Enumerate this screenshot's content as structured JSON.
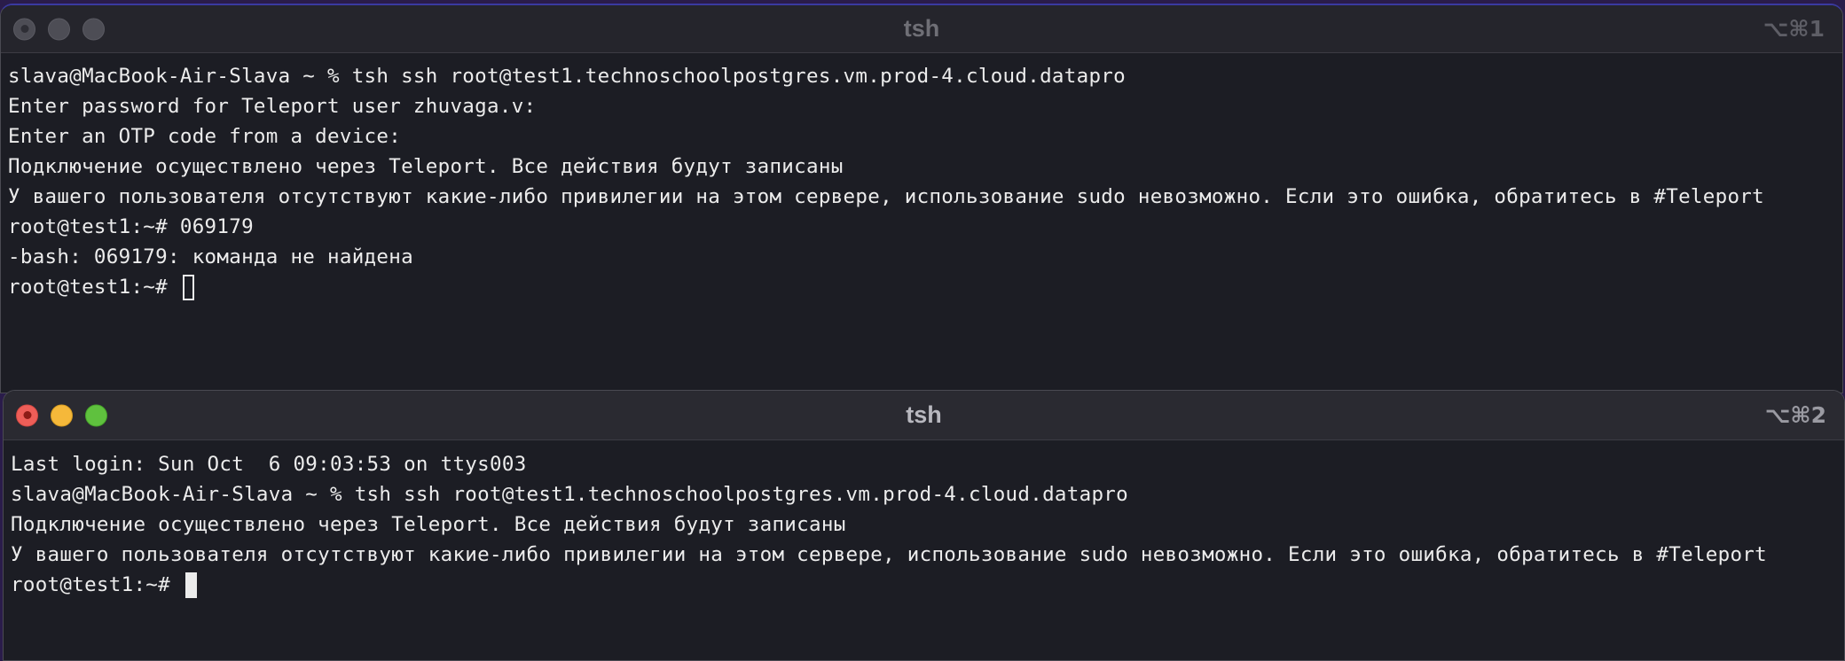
{
  "window1": {
    "title": "tsh",
    "shortcut": "⌥⌘1",
    "lines": [
      "slava@MacBook-Air-Slava ~ % tsh ssh root@test1.technoschoolpostgres.vm.prod-4.cloud.datapro",
      "Enter password for Teleport user zhuvaga.v:",
      "Enter an OTP code from a device:",
      "Подключение осуществлено через Teleport. Все действия будут записаны",
      "У вашего пользователя отсутствуют какие-либо привилегии на этом сервере, использование sudo невозможно. Если это ошибка, обратитесь в #Teleport",
      "root@test1:~# 069179",
      "-bash: 069179: команда не найдена"
    ],
    "prompt": "root@test1:~# "
  },
  "window2": {
    "title": "tsh",
    "shortcut": "⌥⌘2",
    "lines": [
      "Last login: Sun Oct  6 09:03:53 on ttys003",
      "slava@MacBook-Air-Slava ~ % tsh ssh root@test1.technoschoolpostgres.vm.prod-4.cloud.datapro",
      "Подключение осуществлено через Teleport. Все действия будут записаны",
      "У вашего пользователя отсутствуют какие-либо привилегии на этом сервере, использование sudo невозможно. Если это ошибка, обратитесь в #Teleport"
    ],
    "prompt": "root@test1:~# "
  },
  "icons": {
    "close": "close-icon",
    "minimize": "minimize-icon",
    "zoom": "zoom-icon"
  },
  "colors": {
    "terminal_bg": "#1c1d24",
    "text": "#ececec",
    "close_red": "#ee5e58",
    "minimize_yellow": "#f5b83a",
    "zoom_green": "#5fc13e"
  }
}
